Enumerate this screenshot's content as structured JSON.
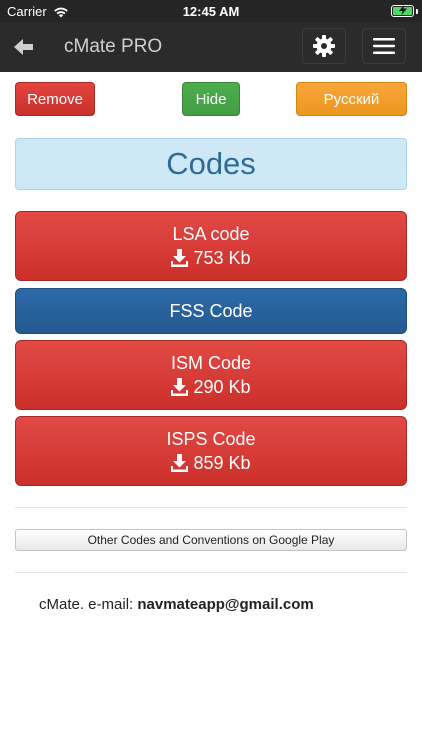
{
  "status_bar": {
    "carrier": "Carrier",
    "time": "12:45 AM",
    "battery_color": "#4cd964"
  },
  "app_bar": {
    "title": "cMate PRO",
    "back_icon": "arrow-left-icon",
    "settings_icon": "gear-icon",
    "menu_icon": "hamburger-menu-icon"
  },
  "actions": {
    "remove_label": "Remove",
    "hide_label": "Hide",
    "language_label": "Русский"
  },
  "header": {
    "title": "Codes"
  },
  "codes": [
    {
      "label": "LSA code",
      "size": "753 Kb",
      "color": "red"
    },
    {
      "label": "FSS Code",
      "color": "blue"
    },
    {
      "label": "ISM Code",
      "size": "290 Kb",
      "color": "red"
    },
    {
      "label": "ISPS Code",
      "size": "859 Kb",
      "color": "red"
    }
  ],
  "play_link": {
    "label": "Other Codes and Conventions on Google Play"
  },
  "contact": {
    "prefix": "cMate. e-mail: ",
    "email": "navmateapp@gmail.com"
  }
}
